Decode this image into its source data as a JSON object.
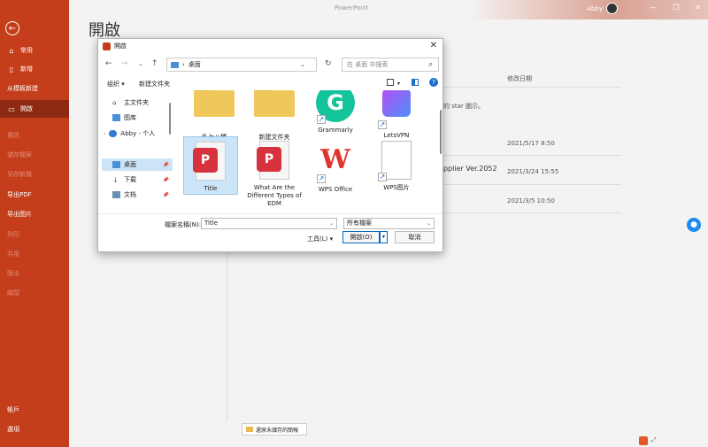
{
  "app": {
    "title": "PowerPoint",
    "user": "Abby"
  },
  "page": {
    "title": "開啟"
  },
  "sidebar": {
    "items": [
      {
        "label": "常用",
        "icon": "home-icon",
        "state": "normal"
      },
      {
        "label": "新增",
        "icon": "new-doc-icon",
        "state": "normal"
      },
      {
        "label": "从模板新建",
        "icon": "template-icon",
        "state": "normal"
      },
      {
        "label": "開啟",
        "icon": "folder-open-icon",
        "state": "active"
      },
      {
        "label": "資訊",
        "state": "dim"
      },
      {
        "label": "儲存檔案",
        "state": "dim"
      },
      {
        "label": "另存新檔",
        "state": "dim"
      },
      {
        "label": "导出PDF",
        "state": "normal"
      },
      {
        "label": "导出图片",
        "state": "normal"
      },
      {
        "label": "列印",
        "state": "dim"
      },
      {
        "label": "共用",
        "state": "dim"
      },
      {
        "label": "匯出",
        "state": "dim"
      },
      {
        "label": "關閉",
        "state": "dim"
      }
    ],
    "bottom": [
      {
        "label": "帳戶"
      },
      {
        "label": "選項"
      }
    ]
  },
  "background": {
    "col_date": "修改日期",
    "note": "的 star 圖示。",
    "rows": [
      {
        "name": "",
        "date": "2021/5/17 8:50"
      },
      {
        "name": "pplier Ver.2052",
        "date": "2021/3/24 15:55"
      },
      {
        "name": "",
        "date": "2021/3/5 10:50"
      }
    ],
    "restore_label": "還原未儲存的簡報"
  },
  "dialog": {
    "title": "開啟",
    "address": "桌面",
    "search_placeholder": "在 桌面 中搜索",
    "toolbar": {
      "organize": "组织",
      "new_folder": "新建文件夹"
    },
    "nav": [
      {
        "label": "主文件夹",
        "icon": "home-icon"
      },
      {
        "label": "图库",
        "icon": "gallery-icon"
      },
      {
        "label": "Abby - 个人",
        "icon": "cloud-icon"
      },
      {
        "label": "桌面",
        "icon": "desktop-icon",
        "selected": true
      },
      {
        "label": "下载",
        "icon": "download-icon"
      },
      {
        "label": "文档",
        "icon": "documents-icon"
      }
    ],
    "files": [
      {
        "label": "乱七八糟",
        "kind": "folder-icon"
      },
      {
        "label": "新建文件夹",
        "kind": "folder-icon"
      },
      {
        "label": "Grammarly",
        "kind": "grammarly-icon"
      },
      {
        "label": "LetsVPN",
        "kind": "letsvpn-icon"
      },
      {
        "label": "Title",
        "kind": "pptx-icon",
        "selected": true
      },
      {
        "label": "What Are the Different Types of EDM",
        "kind": "pptx-icon"
      },
      {
        "label": "WPS Office",
        "kind": "wps-icon"
      },
      {
        "label": "WPS图片",
        "kind": "blank-doc-icon"
      }
    ],
    "filename_label": "檔案名稱(N):",
    "filename_value": "Title",
    "filetype_value": "所有檔案",
    "tools_label": "工具(L)",
    "open_label": "開啟(O)",
    "cancel_label": "取消"
  }
}
